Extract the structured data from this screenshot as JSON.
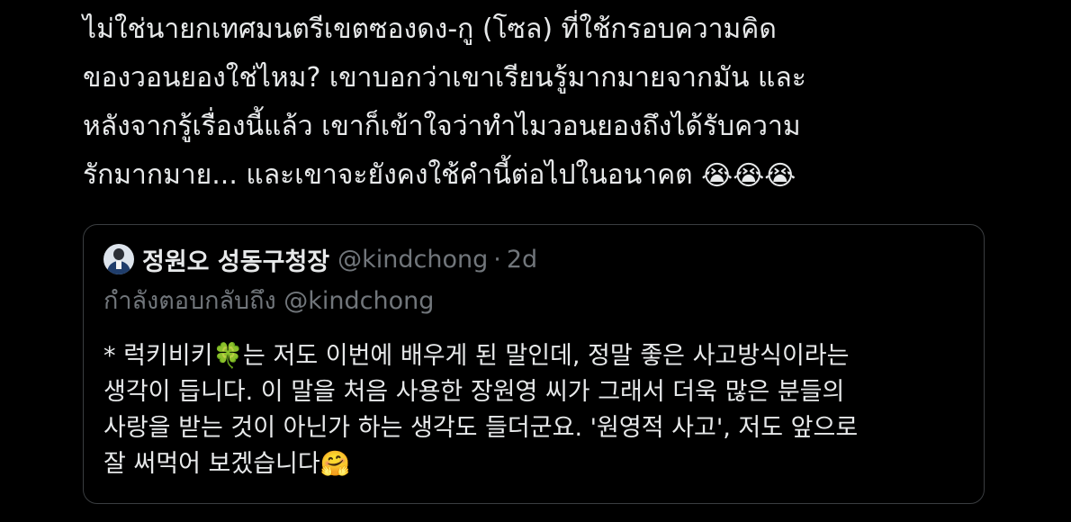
{
  "tweet": {
    "lines": [
      "ไม่ใช่นายกเทศมนตรีเขตซองดง-กู (โซล) ที่ใช้กรอบความคิด",
      "ของวอนยองใช่ไหม? เขาบอกว่าเขาเรียนรู้มากมายจากมัน และ",
      "หลังจากรู้เรื่องนี้แล้ว เขาก็เข้าใจว่าทำไมวอนยองถึงได้รับความ",
      "รักมากมาย... และเขาจะยังคงใช้คำนี้ต่อไปในอนาคต"
    ],
    "emojis": [
      "😭",
      "😭",
      "😭"
    ]
  },
  "quote": {
    "author_name": "정원오 성동구청장",
    "handle": "@kindchong",
    "separator": "·",
    "time": "2d",
    "reply_context": "กำลังตอบกลับถึง @kindchong",
    "lines": [
      "* 럭키비키🍀는 저도 이번에 배우게 된 말인데, 정말 좋은 사고방식이라는",
      "생각이 듭니다. 이 말을 처음 사용한 장원영 씨가 그래서 더욱 많은 분들의",
      "사랑을 받는 것이 아닌가 하는 생각도 들더군요. '원영적 사고', 저도 앞으로",
      "잘 써먹어 보겠습니다🤗"
    ]
  },
  "colors": {
    "background": "#000000",
    "text_primary": "#e7e9ea",
    "text_secondary": "#71767b",
    "border": "#3a3d40"
  },
  "icons": {
    "avatar": "profile-photo-avatar",
    "tweet_emoji": "loudly-crying-face",
    "quote_emojis": [
      "four-leaf-clover",
      "hugging-face"
    ]
  }
}
